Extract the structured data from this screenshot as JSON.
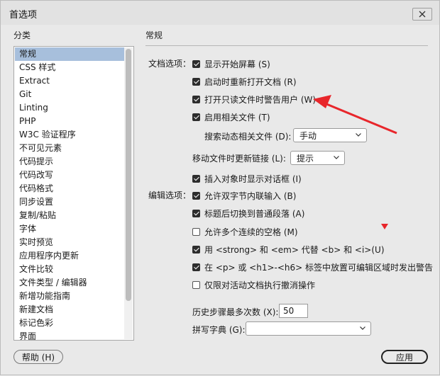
{
  "window": {
    "title": "首选项"
  },
  "sidebar": {
    "heading": "分类",
    "items": [
      {
        "label": "常规",
        "selected": true
      },
      {
        "label": "CSS 样式"
      },
      {
        "label": "Extract"
      },
      {
        "label": "Git"
      },
      {
        "label": "Linting"
      },
      {
        "label": "PHP"
      },
      {
        "label": "W3C 验证程序"
      },
      {
        "label": "不可见元素"
      },
      {
        "label": "代码提示"
      },
      {
        "label": "代码改写"
      },
      {
        "label": "代码格式"
      },
      {
        "label": "同步设置"
      },
      {
        "label": "复制/粘贴"
      },
      {
        "label": "字体"
      },
      {
        "label": "实时预览"
      },
      {
        "label": "应用程序内更新"
      },
      {
        "label": "文件比较"
      },
      {
        "label": "文件类型 / 编辑器"
      },
      {
        "label": "新增功能指南"
      },
      {
        "label": "新建文档"
      },
      {
        "label": "标记色彩"
      },
      {
        "label": "界面"
      }
    ]
  },
  "main": {
    "heading": "常规",
    "doc_options_label": "文档选项：",
    "edit_options_label": "编辑选项：",
    "doc_options": [
      {
        "label": "显示开始屏幕 (S)",
        "checked": true
      },
      {
        "label": "启动时重新打开文档 (R)",
        "checked": true
      },
      {
        "label": "打开只读文件时警告用户 (W)",
        "checked": true
      },
      {
        "label": "启用相关文件 (T)",
        "checked": true
      }
    ],
    "search_related": {
      "label": "搜索动态相关文件 (D):",
      "value": "手动"
    },
    "update_links": {
      "label": "移动文件时更新链接 (L):",
      "value": "提示"
    },
    "insert_dialog": {
      "label": "插入对象时显示对话框 (I)",
      "checked": true
    },
    "edit_options": [
      {
        "label": "允许双字节内联输入 (B)",
        "checked": true
      },
      {
        "label": "标题后切换到普通段落 (A)",
        "checked": true
      },
      {
        "label": "允许多个连续的空格 (M)",
        "checked": false
      },
      {
        "label": "用 <strong> 和 <em> 代替 <b> 和 <i>(U)",
        "checked": true
      },
      {
        "label": "在 <p> 或 <h1>-<h6> 标签中放置可编辑区域时发出警告",
        "checked": true
      },
      {
        "label": "仅限对活动文档执行撤消操作",
        "checked": false
      }
    ],
    "history_steps": {
      "label": "历史步骤最多次数 (X):",
      "value": "50"
    },
    "spell_dict": {
      "label": "拼写字典 (G):",
      "value": ""
    }
  },
  "footer": {
    "help_label": "帮助 (H)",
    "apply_label": "应用"
  },
  "colors": {
    "selection": "#a7bfdc",
    "annotation_red": "#e8262b"
  }
}
